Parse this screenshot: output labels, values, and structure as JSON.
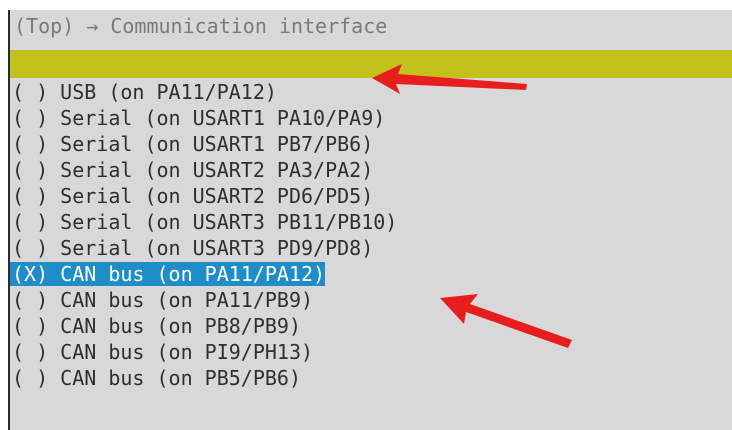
{
  "header": {
    "title": "(Top) → Communication interface"
  },
  "menu": {
    "items": [
      {
        "marker": "( )",
        "label": "USB (on PA11/PA12)",
        "selected": false
      },
      {
        "marker": "( )",
        "label": "Serial (on USART1 PA10/PA9)",
        "selected": false
      },
      {
        "marker": "( )",
        "label": "Serial (on USART1 PB7/PB6)",
        "selected": false
      },
      {
        "marker": "( )",
        "label": "Serial (on USART2 PA3/PA2)",
        "selected": false
      },
      {
        "marker": "( )",
        "label": "Serial (on USART2 PD6/PD5)",
        "selected": false
      },
      {
        "marker": "( )",
        "label": "Serial (on USART3 PB11/PB10)",
        "selected": false
      },
      {
        "marker": "( )",
        "label": "Serial (on USART3 PD9/PD8)",
        "selected": false
      },
      {
        "marker": "(X)",
        "label": "CAN bus (on PA11/PA12)",
        "selected": true
      },
      {
        "marker": "( )",
        "label": "CAN bus (on PA11/PB9)",
        "selected": false
      },
      {
        "marker": "( )",
        "label": "CAN bus (on PB8/PB9)",
        "selected": false
      },
      {
        "marker": "( )",
        "label": "CAN bus (on PI9/PH13)",
        "selected": false
      },
      {
        "marker": "( )",
        "label": "CAN bus (on PB5/PB6)",
        "selected": false
      }
    ]
  },
  "colors": {
    "panel_background": "#d8d8d8",
    "title_text": "#7a7a7a",
    "highlight_bar": "#c2c21c",
    "selected_background": "#1f8dc7",
    "annotation_arrow": "#e81e1e"
  },
  "annotations": {
    "arrow_icon": "red-arrow-icon"
  }
}
